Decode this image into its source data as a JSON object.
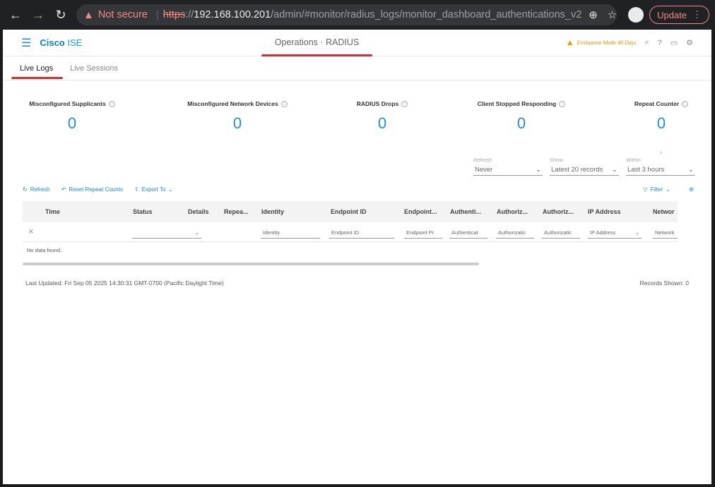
{
  "browser": {
    "warning": "Not secure",
    "scheme": "https",
    "host_sep": "://",
    "host": "192.168.100.201",
    "path": "/admin/#monitor/radius_logs/monitor_dashboard_authentications_v2",
    "update_label": "Update"
  },
  "header": {
    "brand_bold": "Cisco",
    "brand_light": "ISE",
    "title": "Operations · RADIUS",
    "eval_text": "Evaluation Mode 49 Days"
  },
  "tabs": [
    {
      "label": "Live Logs",
      "active": true
    },
    {
      "label": "Live Sessions",
      "active": false
    }
  ],
  "counters": [
    {
      "label": "Misconfigured Supplicants",
      "value": "0"
    },
    {
      "label": "Misconfigured Network Devices",
      "value": "0"
    },
    {
      "label": "RADIUS Drops",
      "value": "0"
    },
    {
      "label": "Client Stopped Responding",
      "value": "0"
    },
    {
      "label": "Repeat Counter",
      "value": "0"
    }
  ],
  "filters": {
    "refresh": {
      "caption": "Refresh",
      "value": "Never"
    },
    "show": {
      "caption": "Show",
      "value": "Latest 20 records"
    },
    "within": {
      "caption": "Within",
      "value": "Last 3 hours"
    }
  },
  "toolbar": {
    "refresh": "Refresh",
    "reset": "Reset Repeat Counts",
    "export": "Export To",
    "filter": "Filter"
  },
  "table": {
    "columns": [
      "Time",
      "Status",
      "Details",
      "Repea...",
      "Identity",
      "Endpoint ID",
      "Endpoint...",
      "Authenti...",
      "Authoriz...",
      "Authoriz...",
      "IP Address",
      "Networ"
    ],
    "filter_placeholders": [
      "Identity",
      "Endpoint ID",
      "Endpoint Pr",
      "Authenticat",
      "Authorizatic",
      "Authorizatic",
      "IP Address",
      "Network"
    ],
    "empty": "No data found."
  },
  "footer": {
    "last_updated": "Last Updated: Fri Sep 05 2025 14:30:31 GMT-0700 (Pacific Daylight Time)",
    "records": "Records Shown: 0"
  }
}
